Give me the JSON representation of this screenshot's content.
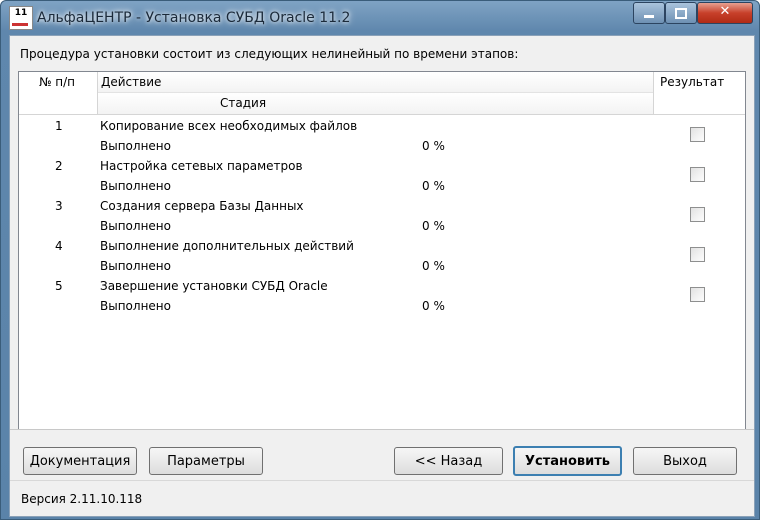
{
  "window": {
    "title": "АльфаЦЕНТР - Установка СУБД Oracle 11.2",
    "icon_text": "11"
  },
  "intro": "Процедура установки состоит из следующих нелинейный по времени этапов:",
  "table": {
    "headers": {
      "num": "№ п/п",
      "action": "Действие",
      "stage": "Стадия",
      "result": "Результат"
    },
    "rows": [
      {
        "num": "1",
        "action": "Копирование всех необходимых файлов",
        "status": "Выполнено",
        "percent": "0 %",
        "checked": false
      },
      {
        "num": "2",
        "action": "Настройка сетевых параметров",
        "status": "Выполнено",
        "percent": "0 %",
        "checked": false
      },
      {
        "num": "3",
        "action": "Создания сервера Базы Данных",
        "status": "Выполнено",
        "percent": "0 %",
        "checked": false
      },
      {
        "num": "4",
        "action": "Выполнение дополнительных действий",
        "status": "Выполнено",
        "percent": "0 %",
        "checked": false
      },
      {
        "num": "5",
        "action": "Завершение установки СУБД Oracle",
        "status": "Выполнено",
        "percent": "0 %",
        "checked": false
      }
    ]
  },
  "buttons": {
    "docs": "Документация",
    "params": "Параметры",
    "back": "<< Назад",
    "install": "Установить",
    "exit": "Выход"
  },
  "version": "Версия 2.11.10.118"
}
